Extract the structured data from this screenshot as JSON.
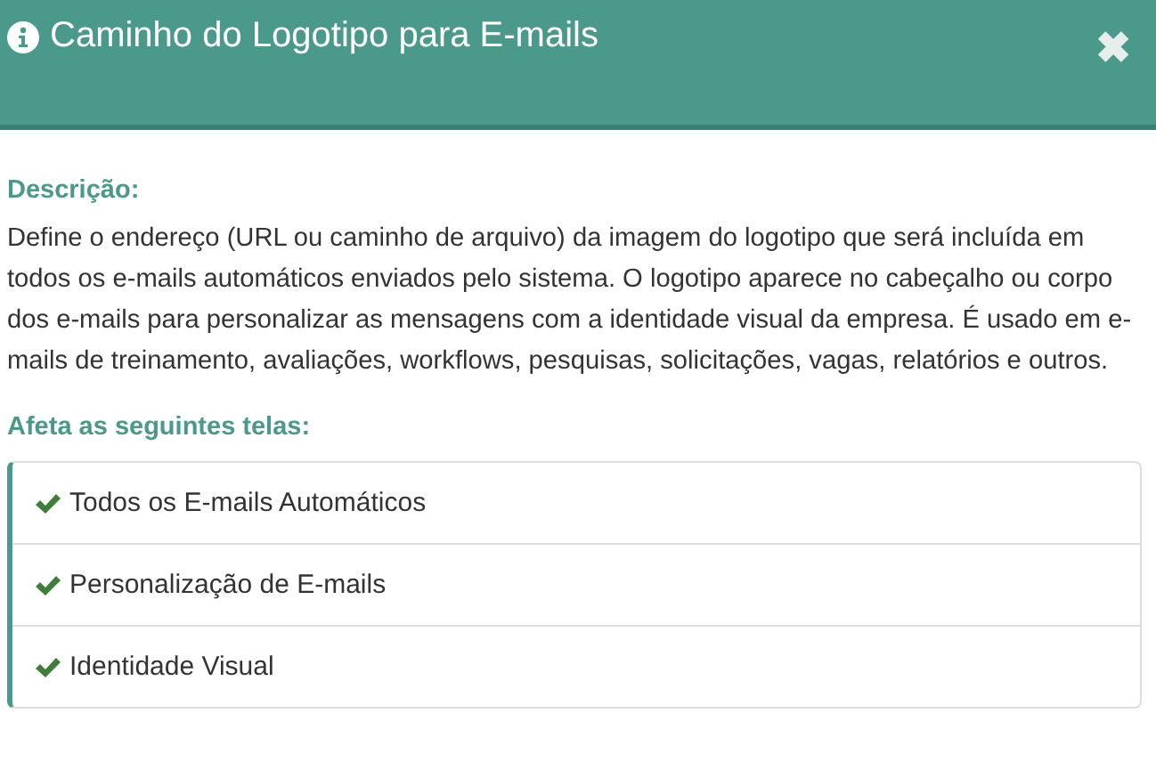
{
  "header": {
    "title": "Caminho do Logotipo para E-mails",
    "close": "✖"
  },
  "description": {
    "heading": "Descrição:",
    "text": "Define o endereço (URL ou caminho de arquivo) da imagem do logotipo que será incluída em todos os e-mails automáticos enviados pelo sistema. O logotipo aparece no cabeçalho ou corpo dos e-mails para personalizar as mensagens com a identidade visual da empresa. É usado em e-mails de treinamento, avaliações, workflows, pesquisas, solicitações, vagas, relatórios e outros."
  },
  "affected": {
    "heading": "Afeta as seguintes telas:",
    "items": [
      {
        "label": "Todos os E-mails Automáticos"
      },
      {
        "label": "Personalização de E-mails"
      },
      {
        "label": "Identidade Visual"
      }
    ]
  }
}
